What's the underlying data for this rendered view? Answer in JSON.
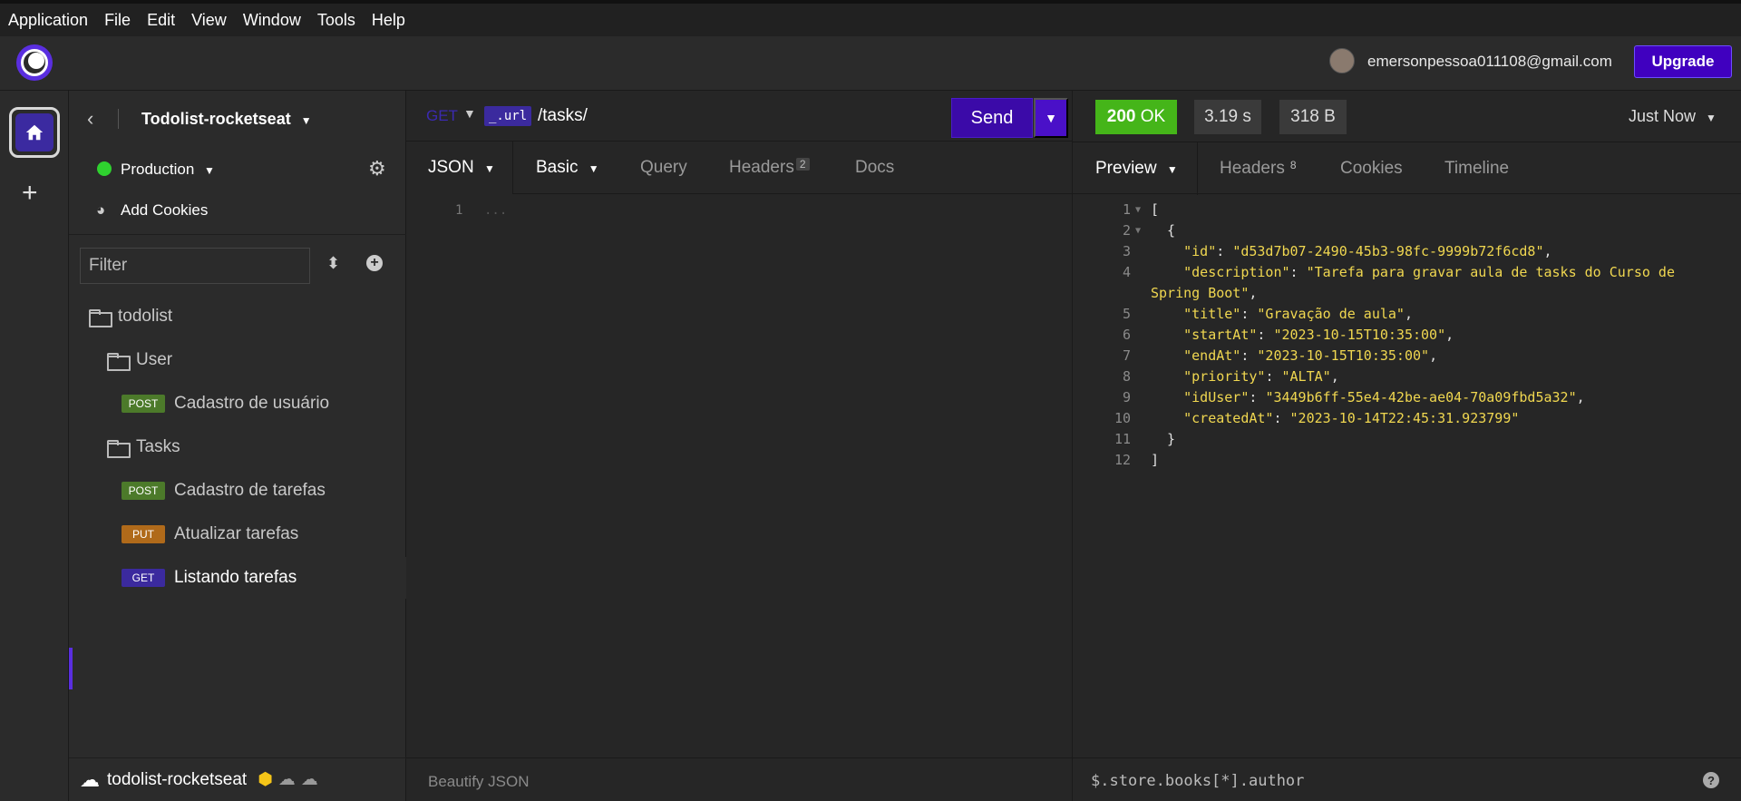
{
  "menu": [
    "Application",
    "File",
    "Edit",
    "View",
    "Window",
    "Tools",
    "Help"
  ],
  "topbar": {
    "email": "emersonpessoa011108@gmail.com",
    "upgrade": "Upgrade"
  },
  "sidebar": {
    "project_name": "Todolist-rocketseat",
    "environment": "Production",
    "add_cookies": "Add Cookies",
    "filter_placeholder": "Filter",
    "tree": [
      {
        "type": "folder",
        "label": "todolist",
        "level": 0
      },
      {
        "type": "folder",
        "label": "User",
        "level": 1
      },
      {
        "type": "request",
        "method": "POST",
        "label": "Cadastro de usuário",
        "level": 2
      },
      {
        "type": "folder",
        "label": "Tasks",
        "level": 1
      },
      {
        "type": "request",
        "method": "POST",
        "label": "Cadastro de tarefas",
        "level": 2
      },
      {
        "type": "request",
        "method": "PUT",
        "label": "Atualizar tarefas",
        "level": 2
      },
      {
        "type": "request",
        "method": "GET",
        "label": "Listando tarefas",
        "level": 2,
        "active": true
      }
    ],
    "footer_project": "todolist-rocketseat"
  },
  "request": {
    "method": "GET",
    "url_var": "_.url",
    "url_path": "/tasks/",
    "send": "Send",
    "tabs": {
      "body": "JSON",
      "auth": "Basic",
      "query": "Query",
      "headers": "Headers",
      "headers_count": "2",
      "docs": "Docs"
    },
    "body_line_number": "1",
    "body_placeholder": "...",
    "beautify": "Beautify JSON"
  },
  "response": {
    "status_code": "200",
    "status_text": "OK",
    "time": "3.19 s",
    "size": "318 B",
    "history": "Just Now",
    "tabs": {
      "preview": "Preview",
      "headers": "Headers",
      "headers_count": "8",
      "cookies": "Cookies",
      "timeline": "Timeline"
    },
    "jsonpath_placeholder": "$.store.books[*].author",
    "lines": [
      {
        "n": "1",
        "fold": true,
        "text": "["
      },
      {
        "n": "2",
        "fold": true,
        "text": "  {"
      },
      {
        "n": "3",
        "key": "\"id\"",
        "value": "\"d53d7b07-2490-45b3-98fc-9999b72f6cd8\"",
        "comma": true
      },
      {
        "n": "4",
        "key": "\"description\"",
        "value": "\"Tarefa para gravar aula de tasks do Curso de",
        "comma": false
      },
      {
        "n": "",
        "wrap": "Spring Boot\"",
        "comma": true
      },
      {
        "n": "5",
        "key": "\"title\"",
        "value": "\"Gravação de aula\"",
        "comma": true
      },
      {
        "n": "6",
        "key": "\"startAt\"",
        "value": "\"2023-10-15T10:35:00\"",
        "comma": true
      },
      {
        "n": "7",
        "key": "\"endAt\"",
        "value": "\"2023-10-15T10:35:00\"",
        "comma": true
      },
      {
        "n": "8",
        "key": "\"priority\"",
        "value": "\"ALTA\"",
        "comma": true
      },
      {
        "n": "9",
        "key": "\"idUser\"",
        "value": "\"3449b6ff-55e4-42be-ae04-70a09fbd5a32\"",
        "comma": true
      },
      {
        "n": "10",
        "key": "\"createdAt\"",
        "value": "\"2023-10-14T22:45:31.923799\"",
        "comma": false
      },
      {
        "n": "11",
        "text": "  }"
      },
      {
        "n": "12",
        "text": "]"
      }
    ]
  },
  "colors": {
    "accent": "#4000bf",
    "status_ok": "#45b519",
    "env_dot": "#2fd12f",
    "json_string": "#f0d750"
  }
}
